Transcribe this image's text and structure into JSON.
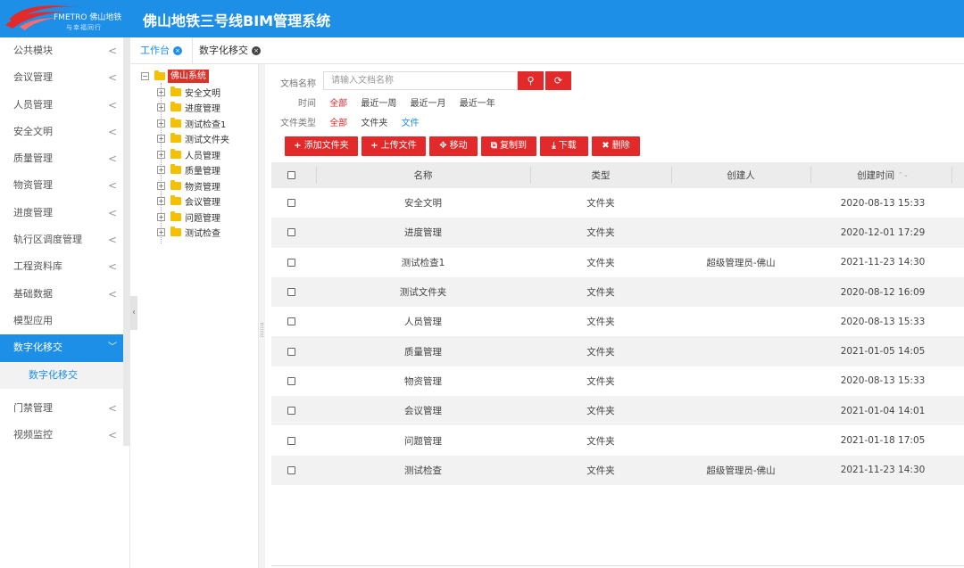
{
  "header": {
    "logo_text": "FMETRO 佛山地铁",
    "logo_sub": "与幸福同行",
    "title": "佛山地铁三号线BIM管理系统",
    "bg_color": "#1e8fe6"
  },
  "sidebar": {
    "items": [
      {
        "label": "公共模块",
        "chevron": "<"
      },
      {
        "label": "会议管理",
        "chevron": "<"
      },
      {
        "label": "人员管理",
        "chevron": "<"
      },
      {
        "label": "安全文明",
        "chevron": "<"
      },
      {
        "label": "质量管理",
        "chevron": "<"
      },
      {
        "label": "物资管理",
        "chevron": "<"
      },
      {
        "label": "进度管理",
        "chevron": "<"
      },
      {
        "label": "轨行区调度管理",
        "chevron": "<"
      },
      {
        "label": "工程资料库",
        "chevron": "<"
      },
      {
        "label": "基础数据",
        "chevron": "<"
      },
      {
        "label": "模型应用",
        "chevron": ""
      },
      {
        "label": "数字化移交",
        "chevron": "﹀",
        "active": true
      },
      {
        "label": "门禁管理",
        "chevron": "<"
      },
      {
        "label": "视频监控",
        "chevron": "<"
      }
    ],
    "active_sub": "数字化移交",
    "collapse_glyph": "‹"
  },
  "tabs": [
    {
      "label": "工作台",
      "close": "×",
      "active": true
    },
    {
      "label": "数字化移交",
      "close": "×",
      "active": false
    }
  ],
  "tree": {
    "root": {
      "label": "佛山系统",
      "toggle": "−"
    },
    "children": [
      {
        "label": "安全文明",
        "toggle": "+"
      },
      {
        "label": "进度管理",
        "toggle": "+"
      },
      {
        "label": "测试检查1",
        "toggle": "+"
      },
      {
        "label": "测试文件夹",
        "toggle": "+"
      },
      {
        "label": "人员管理",
        "toggle": "+"
      },
      {
        "label": "质量管理",
        "toggle": "+"
      },
      {
        "label": "物资管理",
        "toggle": "+"
      },
      {
        "label": "会议管理",
        "toggle": "+"
      },
      {
        "label": "问题管理",
        "toggle": "+"
      },
      {
        "label": "测试检查",
        "toggle": "+"
      }
    ]
  },
  "filters": {
    "doc_name_label": "文档名称",
    "search_placeholder": "请输入文档名称",
    "search_icon": "⚲",
    "refresh_icon": "⟳",
    "time_label": "时间",
    "time_options": [
      "全部",
      "最近一周",
      "最近一月",
      "最近一年"
    ],
    "type_label": "文件类型",
    "type_options": [
      "全部",
      "文件夹",
      "文件"
    ]
  },
  "toolbar": {
    "buttons": [
      {
        "icon": "+",
        "label": "添加文件夹"
      },
      {
        "icon": "+",
        "label": "上传文件"
      },
      {
        "icon": "✥",
        "label": "移动"
      },
      {
        "icon": "⧉",
        "label": "复制到"
      },
      {
        "icon": "⤓",
        "label": "下载"
      },
      {
        "icon": "✖",
        "label": "删除"
      }
    ],
    "accent": "#e32a2a"
  },
  "table": {
    "columns": [
      "名称",
      "类型",
      "创建人",
      "创建时间"
    ],
    "sort_glyph": "⌃⌄",
    "rows": [
      {
        "name": "安全文明",
        "type": "文件夹",
        "creator": "",
        "time": "2020-08-13 15:33"
      },
      {
        "name": "进度管理",
        "type": "文件夹",
        "creator": "",
        "time": "2020-12-01 17:29"
      },
      {
        "name": "测试检查1",
        "type": "文件夹",
        "creator": "超级管理员-佛山",
        "time": "2021-11-23 14:30"
      },
      {
        "name": "测试文件夹",
        "type": "文件夹",
        "creator": "",
        "time": "2020-08-12 16:09"
      },
      {
        "name": "人员管理",
        "type": "文件夹",
        "creator": "",
        "time": "2020-08-13 15:33"
      },
      {
        "name": "质量管理",
        "type": "文件夹",
        "creator": "",
        "time": "2021-01-05 14:05"
      },
      {
        "name": "物资管理",
        "type": "文件夹",
        "creator": "",
        "time": "2020-08-13 15:33"
      },
      {
        "name": "会议管理",
        "type": "文件夹",
        "creator": "",
        "time": "2021-01-04 14:01"
      },
      {
        "name": "问题管理",
        "type": "文件夹",
        "creator": "",
        "time": "2021-01-18 17:05"
      },
      {
        "name": "测试检查",
        "type": "文件夹",
        "creator": "超级管理员-佛山",
        "time": "2021-11-23 14:30"
      }
    ]
  }
}
